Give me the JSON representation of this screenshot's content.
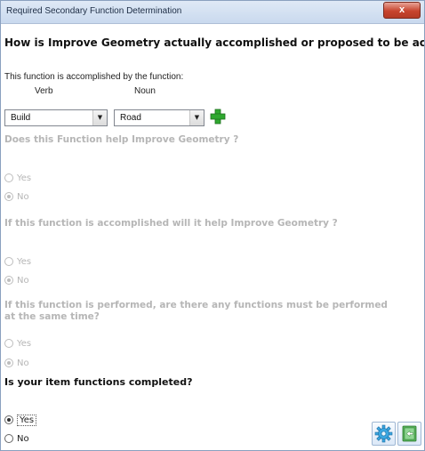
{
  "window": {
    "title": "Required Secondary Function Determination",
    "close_label": "x"
  },
  "main_question": "How is Improve Geometry actually accomplished or proposed to be accomplished?",
  "function_intro": "This function is accomplished by the function:",
  "column_labels": {
    "verb": "Verb",
    "noun": "Noun"
  },
  "verb_select": {
    "value": "Build"
  },
  "noun_select": {
    "value": "Road"
  },
  "questions": [
    {
      "text": "Does this Function help Improve Geometry ?",
      "options": [
        {
          "label": "Yes",
          "checked": false
        },
        {
          "label": "No",
          "checked": true
        }
      ]
    },
    {
      "text": "If this function is accomplished will it help Improve Geometry ?",
      "options": [
        {
          "label": "Yes",
          "checked": false
        },
        {
          "label": "No",
          "checked": true
        }
      ]
    },
    {
      "text": "If this function is performed, are there any functions must be performed at the same time?",
      "options": [
        {
          "label": "Yes",
          "checked": false
        },
        {
          "label": "No",
          "checked": true
        }
      ]
    }
  ],
  "completion": {
    "text": "Is your item functions completed?",
    "options": [
      {
        "label": "Yes",
        "checked": true
      },
      {
        "label": "No",
        "checked": false
      }
    ]
  },
  "icons": {
    "close": "close-icon",
    "add": "plus-icon",
    "settings": "gear-icon",
    "exit": "exit-icon"
  },
  "colors": {
    "add_green": "#2fa82f",
    "disabled_text": "#b6b6b6",
    "title_bar": "#c9d9ee",
    "close_red": "#c7442e"
  }
}
